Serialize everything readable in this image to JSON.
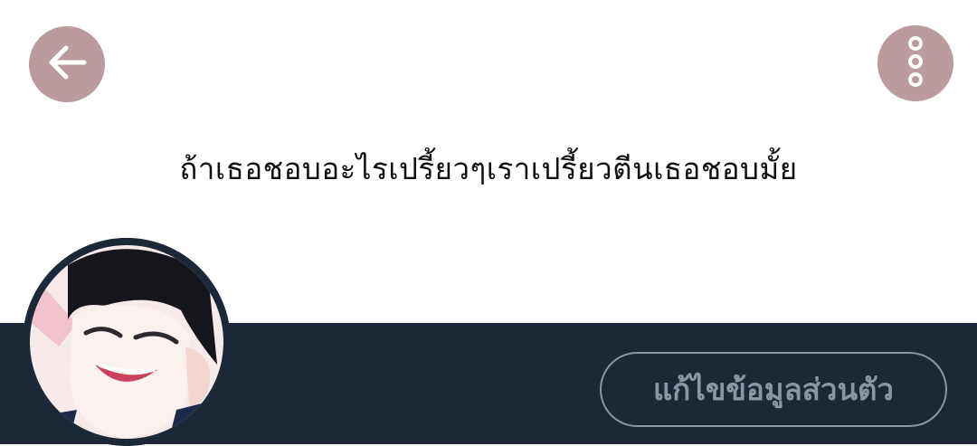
{
  "header": {
    "back_icon": "arrow-left-icon",
    "more_icon": "more-vertical-icon",
    "button_color": "#bb9b9d"
  },
  "banner": {
    "text": "ถ้าเธอชอบอะไรเปรี้ยวๆเราเปรี้ยวตีนเธอชอบมั้ย",
    "background": "#ffffff"
  },
  "profile": {
    "bar_color": "#1c2838",
    "edit_profile_label": "แก้ไขข้อมูลส่วนตัว",
    "edit_profile_color": "#8896a6"
  }
}
